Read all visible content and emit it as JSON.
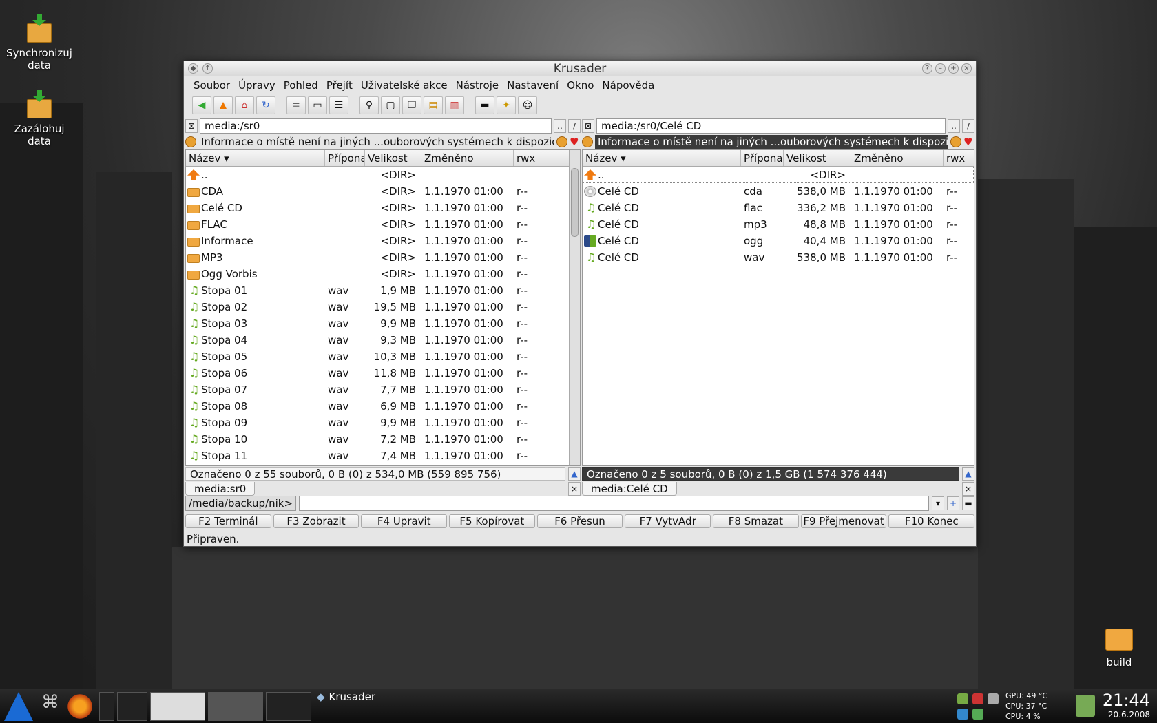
{
  "desktop": {
    "icons": [
      {
        "label": "Synchronizuj data"
      },
      {
        "label": "Zazálohuj data"
      },
      {
        "label": "build"
      }
    ]
  },
  "window": {
    "title": "Krusader",
    "menu": [
      "Soubor",
      "Úpravy",
      "Pohled",
      "Přejít",
      "Uživatelské akce",
      "Nástroje",
      "Nastavení",
      "Okno",
      "Nápověda"
    ],
    "left": {
      "path": "media:/sr0",
      "info": "Informace o místě není na jiných ...ouborových systémech k dispozici",
      "columns": [
        "Název",
        "Přípona",
        "Velikost",
        "Změněno",
        "rwx"
      ],
      "rows": [
        {
          "icon": "up",
          "name": "..",
          "ext": "",
          "size": "<DIR>",
          "date": "",
          "rwx": ""
        },
        {
          "icon": "folder",
          "name": "CDA",
          "ext": "",
          "size": "<DIR>",
          "date": "1.1.1970 01:00",
          "rwx": "r--"
        },
        {
          "icon": "folder",
          "name": "Celé CD",
          "ext": "",
          "size": "<DIR>",
          "date": "1.1.1970 01:00",
          "rwx": "r--"
        },
        {
          "icon": "folder",
          "name": "FLAC",
          "ext": "",
          "size": "<DIR>",
          "date": "1.1.1970 01:00",
          "rwx": "r--"
        },
        {
          "icon": "folder",
          "name": "Informace",
          "ext": "",
          "size": "<DIR>",
          "date": "1.1.1970 01:00",
          "rwx": "r--"
        },
        {
          "icon": "folder",
          "name": "MP3",
          "ext": "",
          "size": "<DIR>",
          "date": "1.1.1970 01:00",
          "rwx": "r--"
        },
        {
          "icon": "folder",
          "name": "Ogg Vorbis",
          "ext": "",
          "size": "<DIR>",
          "date": "1.1.1970 01:00",
          "rwx": "r--"
        },
        {
          "icon": "note",
          "name": "Stopa 01",
          "ext": "wav",
          "size": "1,9 MB",
          "date": "1.1.1970 01:00",
          "rwx": "r--"
        },
        {
          "icon": "note",
          "name": "Stopa 02",
          "ext": "wav",
          "size": "19,5 MB",
          "date": "1.1.1970 01:00",
          "rwx": "r--"
        },
        {
          "icon": "note",
          "name": "Stopa 03",
          "ext": "wav",
          "size": "9,9 MB",
          "date": "1.1.1970 01:00",
          "rwx": "r--"
        },
        {
          "icon": "note",
          "name": "Stopa 04",
          "ext": "wav",
          "size": "9,3 MB",
          "date": "1.1.1970 01:00",
          "rwx": "r--"
        },
        {
          "icon": "note",
          "name": "Stopa 05",
          "ext": "wav",
          "size": "10,3 MB",
          "date": "1.1.1970 01:00",
          "rwx": "r--"
        },
        {
          "icon": "note",
          "name": "Stopa 06",
          "ext": "wav",
          "size": "11,8 MB",
          "date": "1.1.1970 01:00",
          "rwx": "r--"
        },
        {
          "icon": "note",
          "name": "Stopa 07",
          "ext": "wav",
          "size": "7,7 MB",
          "date": "1.1.1970 01:00",
          "rwx": "r--"
        },
        {
          "icon": "note",
          "name": "Stopa 08",
          "ext": "wav",
          "size": "6,9 MB",
          "date": "1.1.1970 01:00",
          "rwx": "r--"
        },
        {
          "icon": "note",
          "name": "Stopa 09",
          "ext": "wav",
          "size": "9,9 MB",
          "date": "1.1.1970 01:00",
          "rwx": "r--"
        },
        {
          "icon": "note",
          "name": "Stopa 10",
          "ext": "wav",
          "size": "7,2 MB",
          "date": "1.1.1970 01:00",
          "rwx": "r--"
        },
        {
          "icon": "note",
          "name": "Stopa 11",
          "ext": "wav",
          "size": "7,4 MB",
          "date": "1.1.1970 01:00",
          "rwx": "r--"
        }
      ],
      "status": "Označeno 0 z 55 souborů, 0 B  (0) z 534,0 MB (559 895 756)",
      "tab": "media:sr0"
    },
    "right": {
      "path": "media:/sr0/Celé CD",
      "info": "Informace o místě není na jiných ...ouborových systémech k dispozic",
      "columns": [
        "Název",
        "Přípona",
        "Velikost",
        "Změněno",
        "rwx"
      ],
      "rows": [
        {
          "icon": "up",
          "name": "..",
          "ext": "",
          "size": "<DIR>",
          "date": "",
          "rwx": ""
        },
        {
          "icon": "cd",
          "name": "Celé CD",
          "ext": "cda",
          "size": "538,0 MB",
          "date": "1.1.1970 01:00",
          "rwx": "r--"
        },
        {
          "icon": "note",
          "name": "Celé CD",
          "ext": "flac",
          "size": "336,2 MB",
          "date": "1.1.1970 01:00",
          "rwx": "r--"
        },
        {
          "icon": "note",
          "name": "Celé CD",
          "ext": "mp3",
          "size": "48,8 MB",
          "date": "1.1.1970 01:00",
          "rwx": "r--"
        },
        {
          "icon": "ogg",
          "name": "Celé CD",
          "ext": "ogg",
          "size": "40,4 MB",
          "date": "1.1.1970 01:00",
          "rwx": "r--"
        },
        {
          "icon": "note",
          "name": "Celé CD",
          "ext": "wav",
          "size": "538,0 MB",
          "date": "1.1.1970 01:00",
          "rwx": "r--"
        }
      ],
      "status": "Označeno 0 z 5 souborů, 0 B  (0) z 1,5 GB (1 574 376 444)",
      "tab": "media:Celé CD"
    },
    "cmdline": {
      "path": "/media/backup/nik>",
      "value": ""
    },
    "fkeys": [
      "F2 Terminál",
      "F3 Zobrazit",
      "F4 Upravit",
      "F5 Kopírovat",
      "F6 Přesun",
      "F7 VytvAdr",
      "F8 Smazat",
      "F9 Přejmenovat",
      "F10 Konec"
    ],
    "statusbar": "Připraven."
  },
  "taskbar": {
    "task": "Krusader",
    "sensors": [
      "GPU: 49 °C",
      "CPU: 37 °C",
      "CPU: 4 %"
    ],
    "time": "21:44",
    "date": "20.6.2008"
  }
}
